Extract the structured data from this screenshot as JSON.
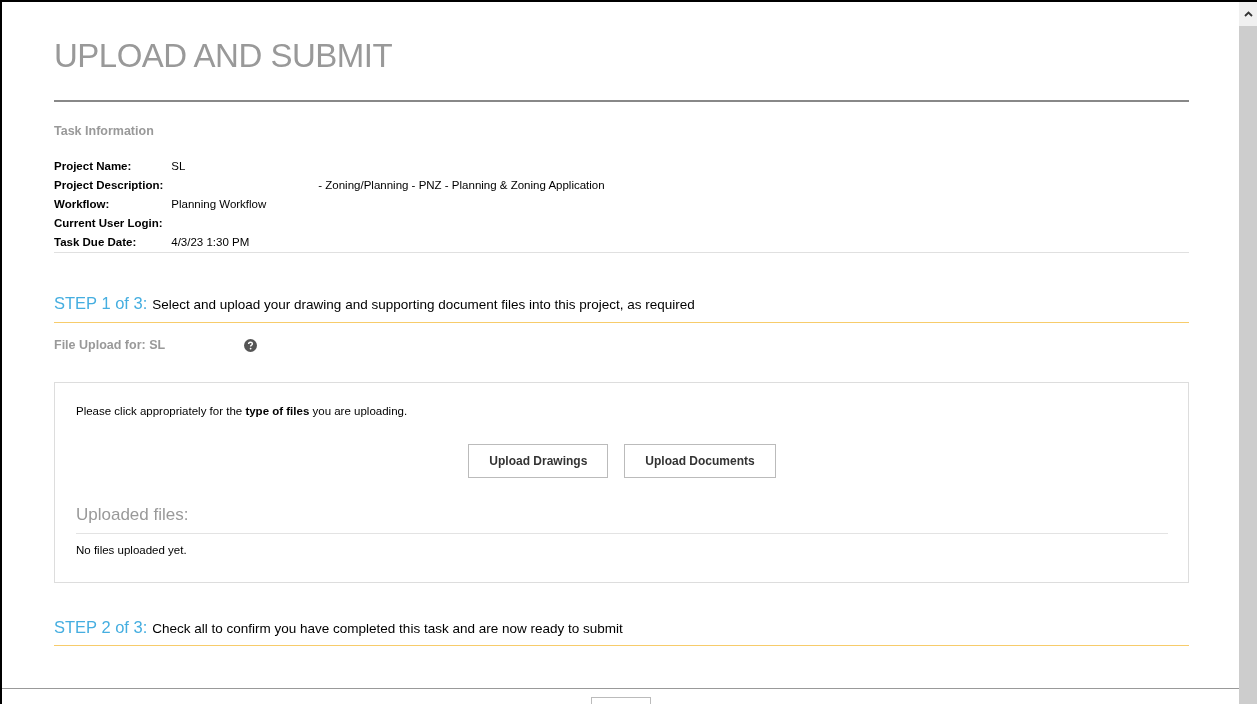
{
  "title": "UPLOAD AND SUBMIT",
  "task_information": {
    "heading": "Task Information",
    "fields": [
      {
        "label": "Project Name:",
        "value": "SL"
      },
      {
        "label": "Project Description:",
        "value": "- Zoning/Planning - PNZ - Planning & Zoning Application",
        "indented": true
      },
      {
        "label": "Workflow:",
        "value": "Planning Workflow"
      },
      {
        "label": "Current User Login:"
      },
      {
        "label": "Task Due Date:",
        "value": "4/3/23 1:30 PM"
      }
    ]
  },
  "step_1": {
    "step": "STEP 1 of 3:",
    "text": "Select and upload your drawing and supporting document files into this project, as required",
    "file_upload_label": "File Upload for: SL",
    "instructions": "Please click appropriately for the **type of files** you are uploading.",
    "buttons": [
      "Upload Drawings",
      "Upload Documents"
    ],
    "uploaded_heading": "Uploaded files:",
    "uploaded_status": "No files uploaded yet."
  },
  "step_2": {
    "step": "STEP 2 of 3:",
    "text": "Check all to confirm you have completed this task and are now ready to submit"
  }
}
